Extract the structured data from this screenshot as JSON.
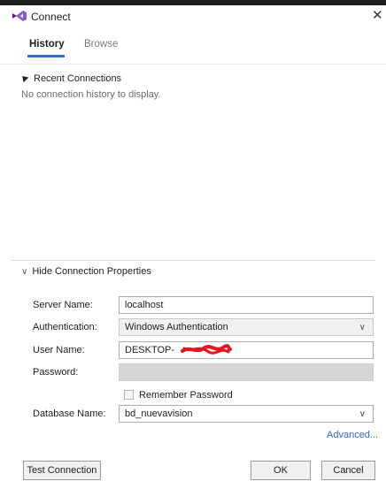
{
  "window": {
    "title": "Connect",
    "close_glyph": "✕"
  },
  "tabs": [
    {
      "label": "History",
      "active": true
    },
    {
      "label": "Browse",
      "active": false
    }
  ],
  "recent": {
    "header": "Recent Connections",
    "empty_message": "No connection history to display."
  },
  "properties": {
    "toggle_label": "Hide Connection Properties",
    "server_name_label": "Server Name:",
    "server_name_value": "localhost",
    "authentication_label": "Authentication:",
    "authentication_value": "Windows Authentication",
    "user_name_label": "User Name:",
    "user_name_value": "DESKTOP-",
    "password_label": "Password:",
    "remember_password_label": "Remember Password",
    "database_name_label": "Database Name:",
    "database_name_value": "bd_nuevavision",
    "advanced_link": "Advanced..."
  },
  "buttons": {
    "test_connection": "Test Connection",
    "ok": "OK",
    "cancel": "Cancel"
  },
  "colors": {
    "accent": "#2f6fd0",
    "link": "#2c6ad1",
    "logo_purple": "#68217a",
    "redaction": "#e8141e"
  },
  "icons": {
    "logo": "visual-studio-logo-icon",
    "collapse_triangle": "triangle-down-icon",
    "chevron": "chevron-down-icon",
    "combo_caret": "dropdown-caret-icon"
  }
}
